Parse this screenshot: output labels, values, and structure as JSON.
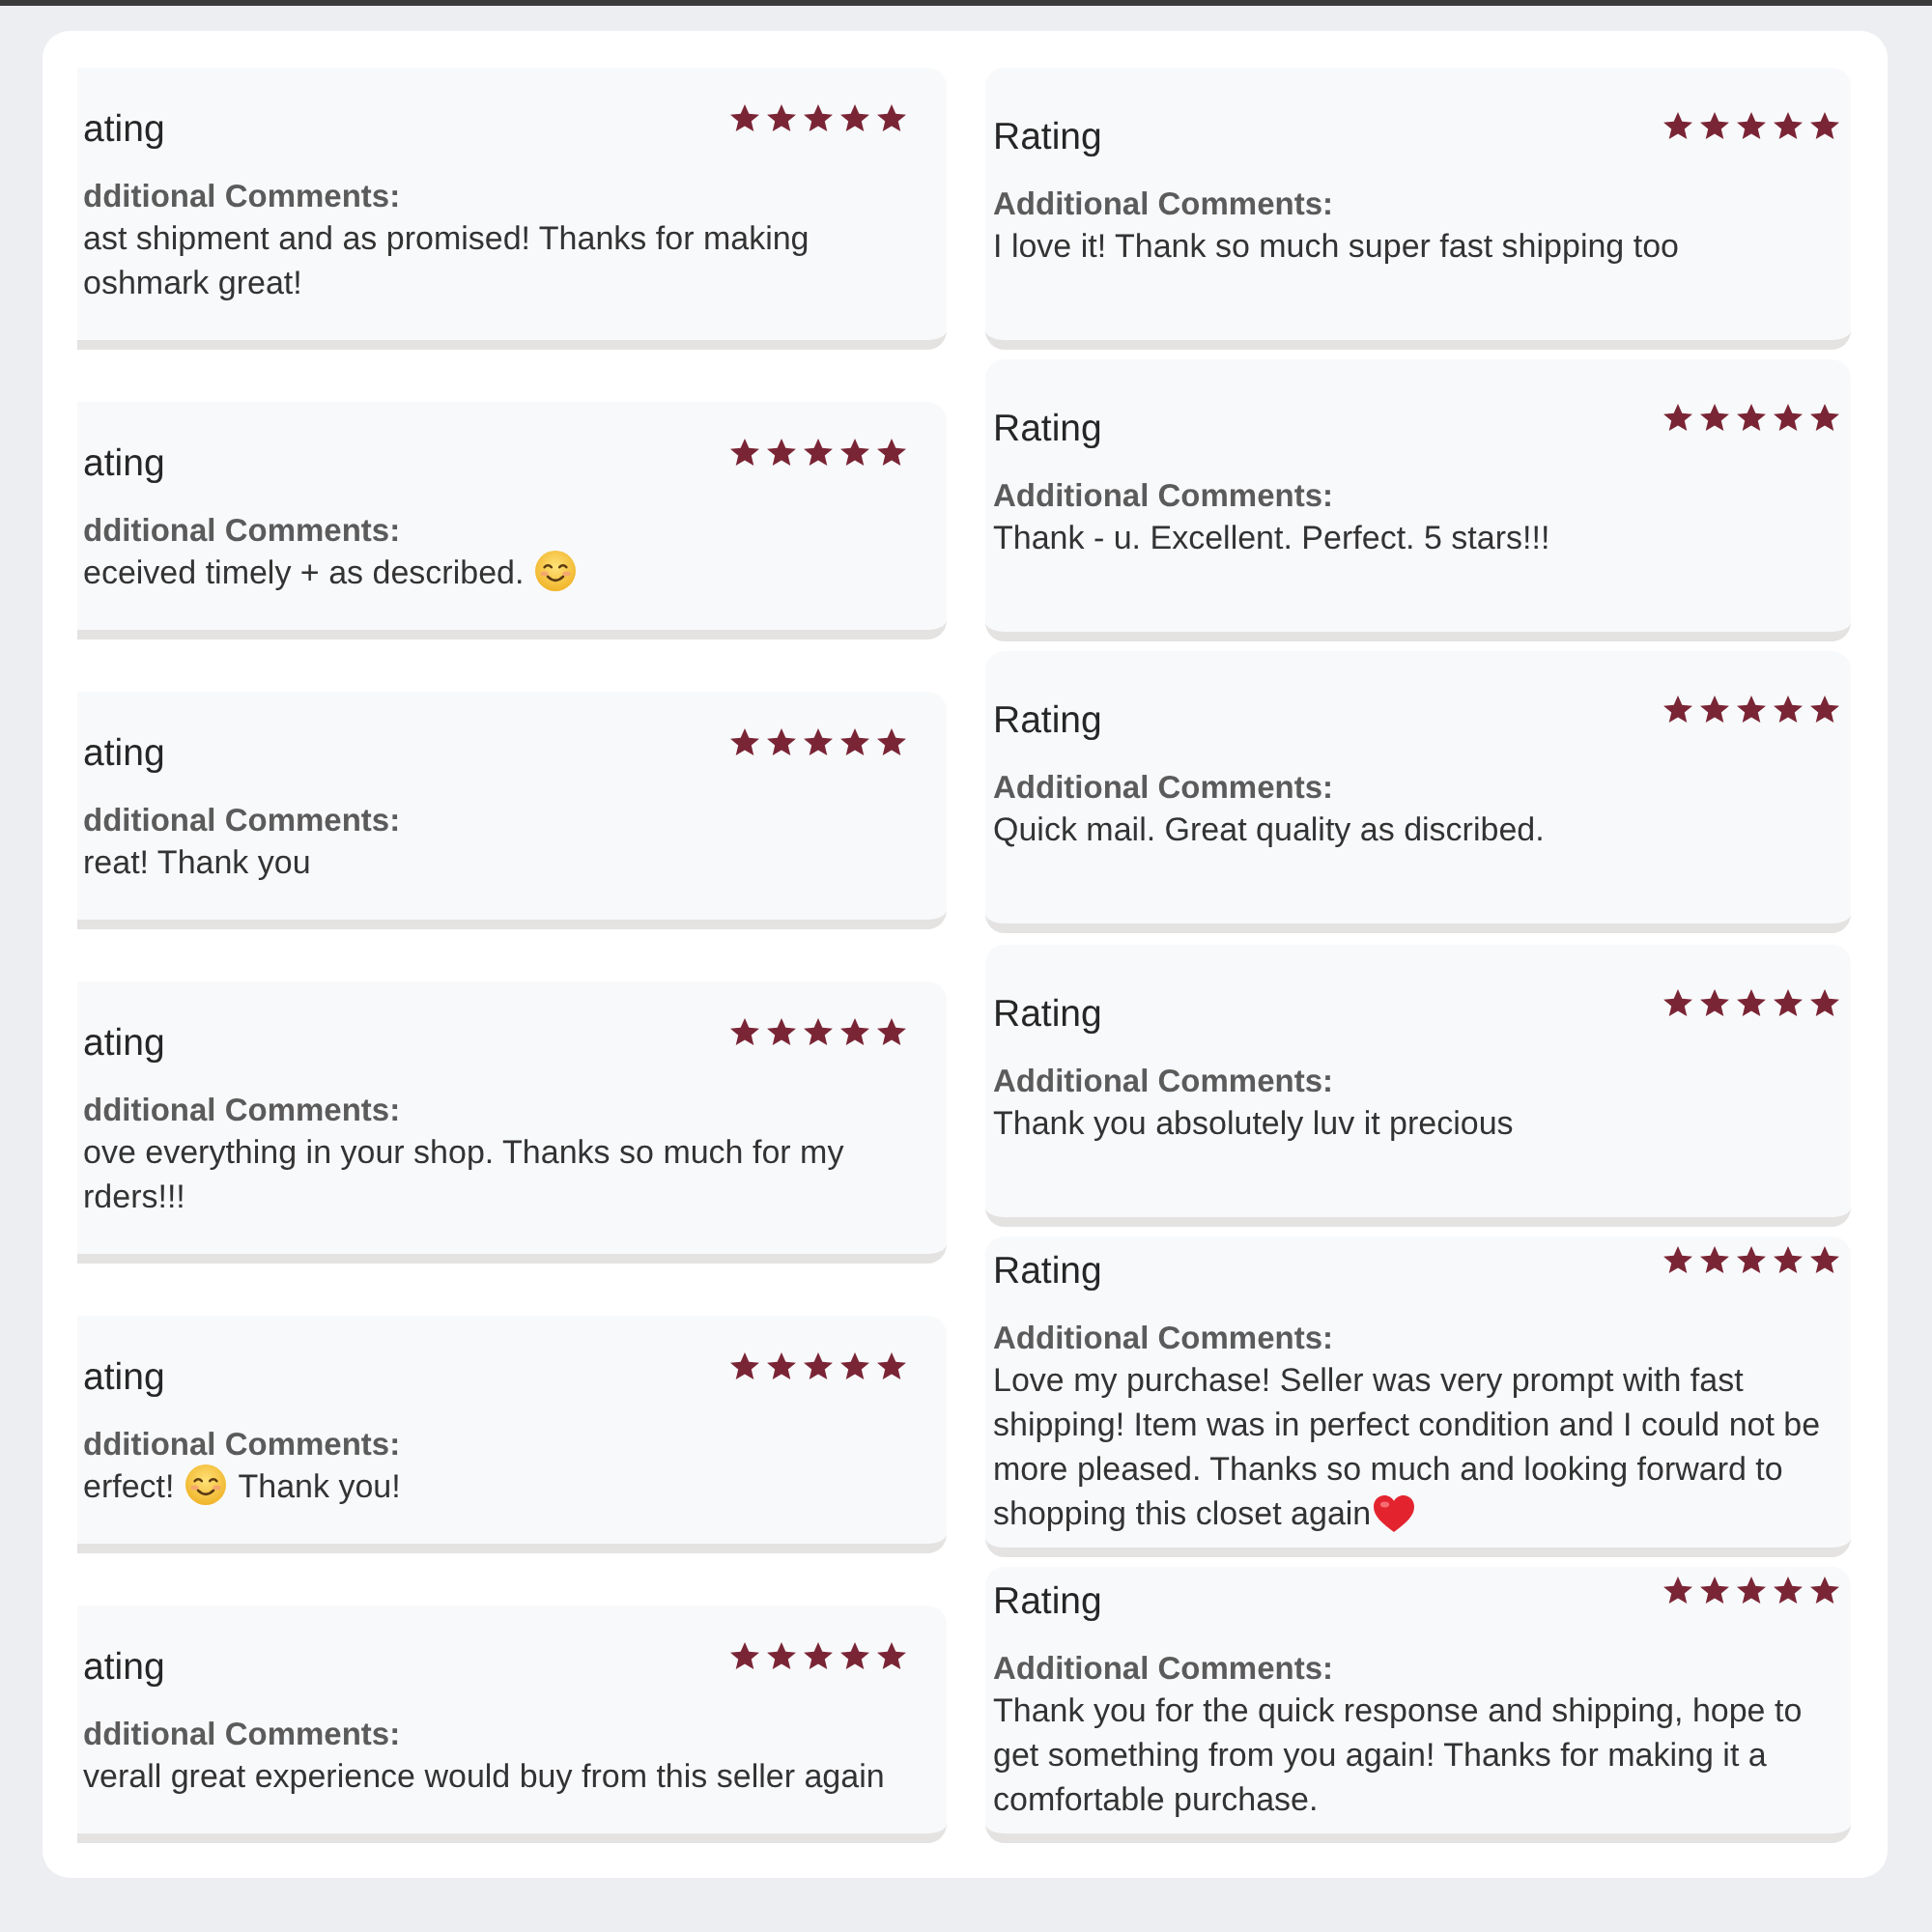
{
  "columns": [
    {
      "cards": [
        {
          "title": "ating",
          "stars": 5,
          "comments_label": "dditional Comments:",
          "comment": [
            {
              "kind": "text",
              "text": "ast shipment and as promised! Thanks for making\noshmark great!"
            }
          ]
        },
        {
          "title": "ating",
          "stars": 5,
          "comments_label": "dditional Comments:",
          "comment": [
            {
              "kind": "text",
              "text": "eceived timely + as described."
            },
            {
              "kind": "smiley"
            }
          ]
        },
        {
          "title": "ating",
          "stars": 5,
          "comments_label": "dditional Comments:",
          "comment": [
            {
              "kind": "text",
              "text": "reat! Thank you"
            }
          ]
        },
        {
          "title": "ating",
          "stars": 5,
          "comments_label": "dditional Comments:",
          "comment": [
            {
              "kind": "text",
              "text": "ove everything in your shop. Thanks so much for my\nrders!!!"
            }
          ]
        },
        {
          "title": "ating",
          "stars": 5,
          "comments_label": "dditional Comments:",
          "comment": [
            {
              "kind": "text",
              "text": "erfect!"
            },
            {
              "kind": "smiley"
            },
            {
              "kind": "text",
              "text": "Thank you!"
            }
          ]
        },
        {
          "title": "ating",
          "stars": 5,
          "comments_label": "dditional Comments:",
          "comment": [
            {
              "kind": "text",
              "text": "verall great experience would buy from this seller again"
            }
          ]
        }
      ]
    },
    {
      "cards": [
        {
          "title": "Rating",
          "stars": 5,
          "comments_label": "Additional Comments:",
          "comment": [
            {
              "kind": "text",
              "text": "I love it! Thank so much super fast shipping too"
            }
          ]
        },
        {
          "title": "Rating",
          "stars": 5,
          "comments_label": "Additional Comments:",
          "comment": [
            {
              "kind": "text",
              "text": "Thank - u. Excellent. Perfect. 5 stars!!!"
            }
          ]
        },
        {
          "title": "Rating",
          "stars": 5,
          "comments_label": "Additional Comments:",
          "comment": [
            {
              "kind": "text",
              "text": "Quick mail. Great quality as discribed."
            }
          ]
        },
        {
          "title": "Rating",
          "stars": 5,
          "comments_label": "Additional Comments:",
          "comment": [
            {
              "kind": "text",
              "text": "Thank you absolutely luv it precious"
            }
          ]
        },
        {
          "title": "Rating",
          "stars": 5,
          "comments_label": "Additional Comments:",
          "comment": [
            {
              "kind": "text",
              "text": "Love my purchase! Seller was very prompt with fast\nshipping! Item was in perfect condition and I could not be\nmore pleased. Thanks so much and looking forward to"
            },
            {
              "kind": "text",
              "text": "shopping this closet again"
            },
            {
              "kind": "heart"
            }
          ]
        },
        {
          "title": "Rating",
          "stars": 5,
          "comments_label": "Additional Comments:",
          "comment": [
            {
              "kind": "text",
              "text": "Thank you for the quick response and shipping, hope to\nget something from you again! Thanks for making it a\ncomfortable purchase."
            }
          ]
        }
      ]
    }
  ]
}
